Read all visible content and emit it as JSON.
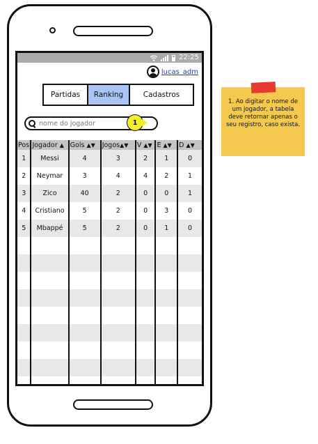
{
  "status_bar": {
    "time": "22:25"
  },
  "user": {
    "name": "lucas_adm"
  },
  "tabs": [
    {
      "label": "Partidas",
      "active": false
    },
    {
      "label": "Ranking",
      "active": true
    },
    {
      "label": "Cadastros",
      "active": false
    }
  ],
  "search": {
    "placeholder": "nome do jogador",
    "marker": "1"
  },
  "table": {
    "headers": [
      "Pos",
      "Jogador",
      "Gols",
      "Jogos",
      "V",
      "E",
      "D"
    ],
    "rows": [
      [
        "1",
        "Messi",
        "4",
        "3",
        "2",
        "1",
        "0"
      ],
      [
        "2",
        "Neymar",
        "3",
        "4",
        "4",
        "2",
        "1"
      ],
      [
        "3",
        "Zico",
        "40",
        "2",
        "0",
        "0",
        "1"
      ],
      [
        "4",
        "Cristiano",
        "5",
        "2",
        "0",
        "3",
        "0"
      ],
      [
        "5",
        "Mbappé",
        "5",
        "2",
        "0",
        "1",
        "0"
      ]
    ]
  },
  "note": {
    "text": "1. Ao digitar o nome de um jogador, a tabela deve retornar apenas o seu registro, caso exista.",
    "color": "#f5c94e",
    "tape_color": "#e63a2c"
  },
  "colors": {
    "active_tab": "#a9c4f5",
    "header_bg": "#c4c4c4",
    "stripe": "#e8e8e8",
    "link": "#1a3fc9",
    "marker": "#f4ee29"
  }
}
